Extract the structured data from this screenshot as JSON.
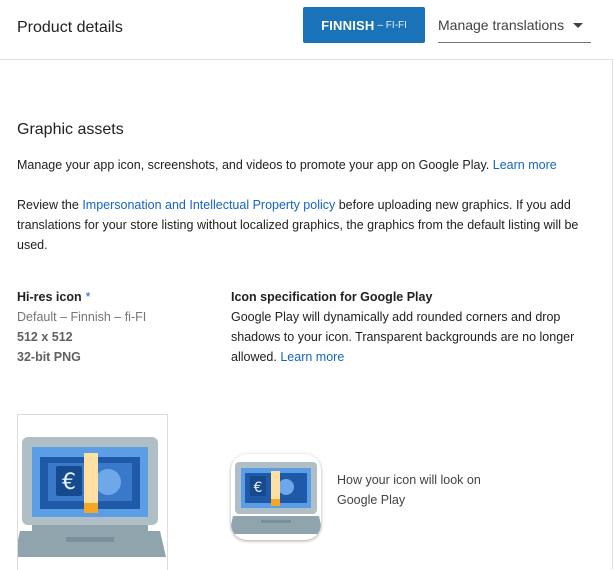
{
  "header": {
    "title": "Product details",
    "language_button": {
      "name": "FINNISH",
      "code": "– FI-FI"
    },
    "manage_dropdown": {
      "label": "Manage translations"
    }
  },
  "graphic_assets": {
    "title": "Graphic assets",
    "intro_text": "Manage your app icon, screenshots, and videos to promote your app on Google Play.",
    "intro_link": "Learn more",
    "review_prefix": "Review the",
    "policy_link": "Impersonation and Intellectual Property policy",
    "review_suffix": "before uploading new graphics. If you add translations for your store listing without localized graphics, the graphics from the default listing will be used."
  },
  "hires_icon": {
    "label": "Hi-res icon",
    "required_marker": "*",
    "locale": "Default – Finnish – fi-FI",
    "size": "512 x 512",
    "format": "32-bit PNG"
  },
  "icon_spec": {
    "title": "Icon specification for Google Play",
    "text": "Google Play will dynamically add rounded corners and drop shadows to your icon. Transparent backgrounds are no longer allowed.",
    "link": "Learn more"
  },
  "preview": {
    "caption": "How your icon will look on Google Play"
  },
  "icon_art": {
    "name": "laptop-euro-icon",
    "colors": {
      "body": "#b0bec5",
      "screen": "#5c9ee6",
      "bill": "#1e5aa8",
      "band": "#ffe0a3",
      "band_accent": "#f5a623",
      "base": "#90a4ae"
    }
  }
}
